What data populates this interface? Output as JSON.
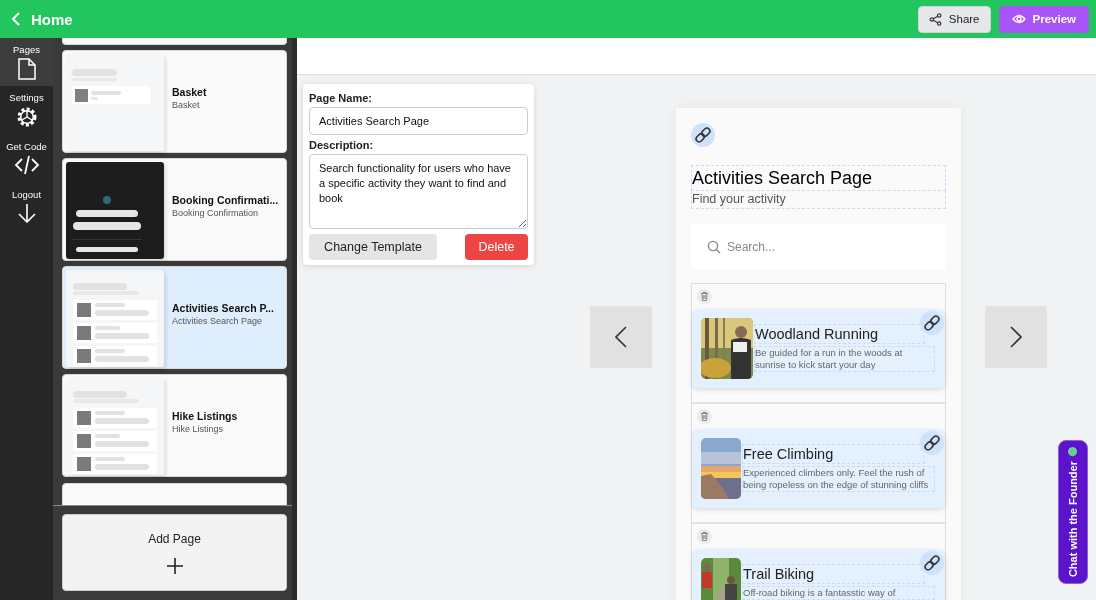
{
  "header": {
    "title": "Home",
    "buttons": [
      {
        "label": "Share",
        "kind": "share"
      },
      {
        "label": "Preview",
        "kind": "preview"
      }
    ]
  },
  "nav": [
    {
      "label": "Pages",
      "kind": "page",
      "selected": true
    },
    {
      "label": "Settings",
      "kind": "gear",
      "selected": false
    },
    {
      "label": "Get Code",
      "kind": "code",
      "selected": false
    },
    {
      "label": "Logout",
      "kind": "logout",
      "selected": false
    }
  ],
  "pages": [
    {
      "title": "Basket",
      "subtitle": "Basket",
      "kind": "basket",
      "selected": false
    },
    {
      "title": "Booking Confirmati...",
      "subtitle": "Booking Confirmation",
      "kind": "dark",
      "selected": false
    },
    {
      "title": "Activities Search P...",
      "subtitle": "Activities Search Page",
      "kind": "list",
      "selected": true
    },
    {
      "title": "Hike Listings",
      "subtitle": "Hike Listings",
      "kind": "list",
      "selected": false
    }
  ],
  "add_page": {
    "label": "Add Page"
  },
  "page_editor": {
    "name_label": "Page Name:",
    "name_value": "Activities Search Page",
    "description_label": "Description:",
    "description_value": "Search functionality for users who have a specific activity they want to find and book",
    "buttons": [
      {
        "label": "Change Template",
        "kind": "secondary"
      },
      {
        "label": "Delete",
        "kind": "danger"
      }
    ]
  },
  "preview": {
    "title": "Activities Search Page",
    "subtitle": "Find your activity",
    "search_placeholder": "Search...",
    "items": [
      {
        "title": "Woodland Running",
        "description": "Be guided for a run in the woods at sunrise to kick start your day"
      },
      {
        "title": "Free Climbing",
        "description": "Experienced climbers only. Feel the rush of being ropeless on the edge of stunning cliffs"
      },
      {
        "title": "Trail Biking",
        "description": "Off-road biking is a fantasstic way of"
      }
    ]
  },
  "chat_tab": {
    "label": "Chat with the Founder"
  }
}
